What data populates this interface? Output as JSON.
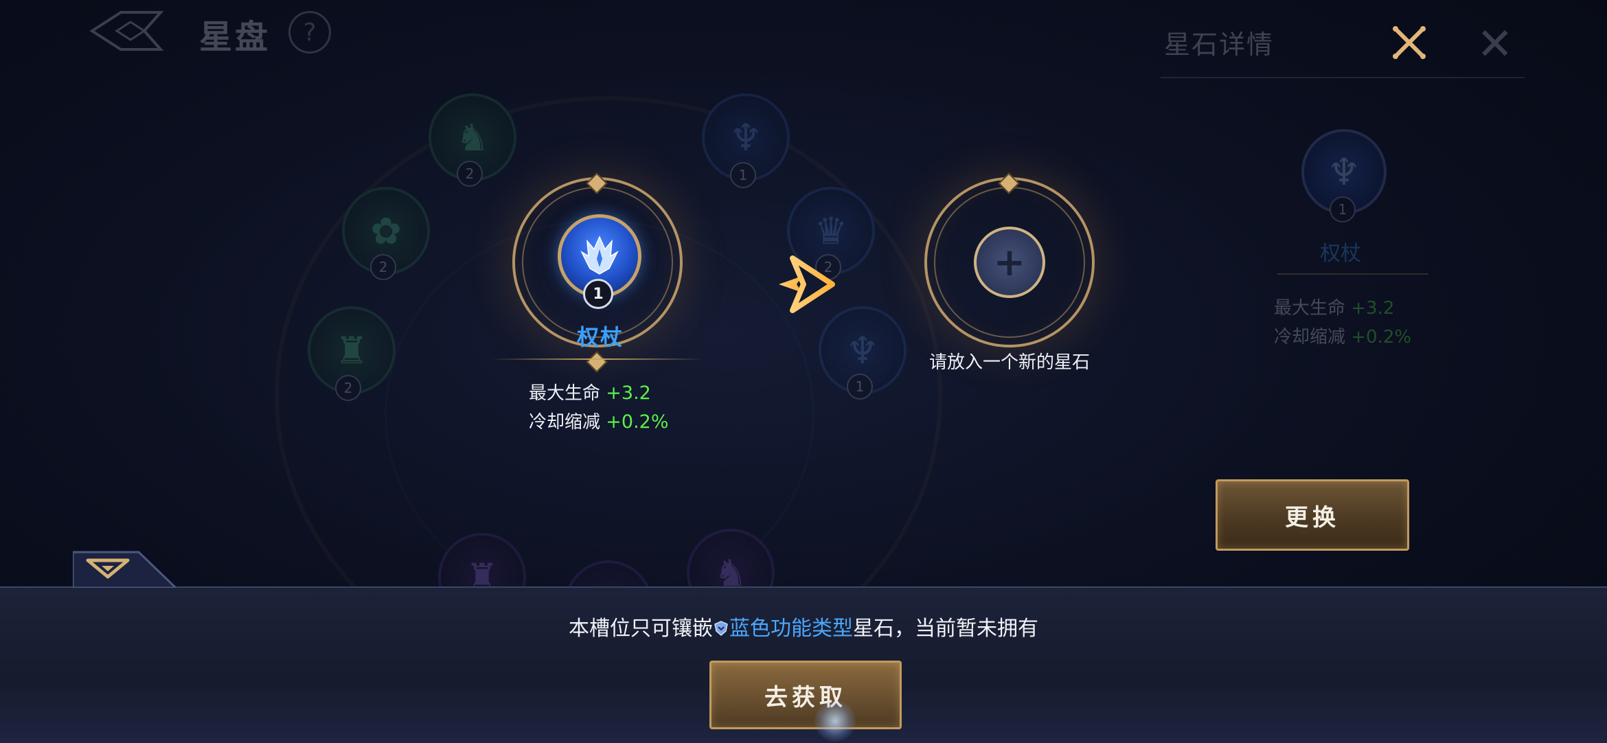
{
  "header": {
    "title": "星盘",
    "help_label": "?"
  },
  "background_nodes": [
    {
      "badge": "2"
    },
    {
      "badge": "1"
    },
    {
      "badge": "2"
    },
    {
      "badge": "2"
    },
    {
      "badge": "2"
    },
    {
      "badge": "1"
    }
  ],
  "detail_panel": {
    "title": "星石详情",
    "gem_level": "1",
    "gem_name": "权杖",
    "stats": [
      {
        "label": "最大生命 ",
        "value": "+3.2"
      },
      {
        "label": "冷却缩减 ",
        "value": "+0.2%"
      }
    ]
  },
  "current_gem": {
    "level": "1",
    "name": "权杖",
    "stats": [
      {
        "label": "最大生命 ",
        "value": "+3.2"
      },
      {
        "label": "冷却缩减 ",
        "value": "+0.2%"
      }
    ]
  },
  "new_slot": {
    "plus": "+",
    "hint": "请放入一个新的星石"
  },
  "buttons": {
    "swap": "更换",
    "obtain": "去获取"
  },
  "bottom_message": {
    "prefix": "本槽位只可镶嵌",
    "type_name": "蓝色功能类型",
    "suffix": "星石，当前暂未拥有"
  },
  "colors": {
    "accent_gold": "#c39a5c",
    "gem_name_blue": "#3aa0ff",
    "stat_green": "#5cf04a",
    "link_blue": "#4aa8ff"
  }
}
